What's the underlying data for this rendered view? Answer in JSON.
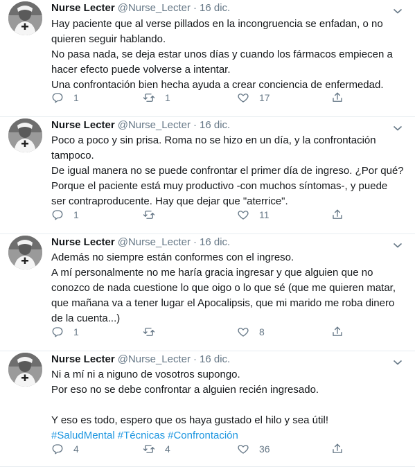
{
  "tweets": [
    {
      "name": "Nurse Lecter",
      "handle": "@Nurse_Lecter",
      "sep": "·",
      "date": "16 dic.",
      "lines": [
        "Hay paciente que al verse pillados en la incongruencia se enfadan, o no quieren seguir hablando.",
        "No pasa nada, se deja estar unos días y cuando los fármacos empiecen a hacer efecto puede volverse a intentar.",
        "Una confrontación bien hecha ayuda a crear conciencia de enfermedad."
      ],
      "hashtags": [],
      "replies": "1",
      "retweets": "1",
      "likes": "17"
    },
    {
      "name": "Nurse Lecter",
      "handle": "@Nurse_Lecter",
      "sep": "·",
      "date": "16 dic.",
      "lines": [
        "Poco a poco y sin prisa. Roma no se hizo en un día, y la confrontación tampoco.",
        "De igual manera no se puede confrontar el primer día de ingreso. ¿Por qué? Porque el paciente está muy productivo -con muchos síntomas-, y puede ser contraproducente. Hay que dejar que \"aterrice\"."
      ],
      "hashtags": [],
      "replies": "1",
      "retweets": "",
      "likes": "11"
    },
    {
      "name": "Nurse Lecter",
      "handle": "@Nurse_Lecter",
      "sep": "·",
      "date": "16 dic.",
      "lines": [
        "Además no siempre están conformes con el ingreso.",
        "A mí personalmente no me haría gracia ingresar y que alguien que no conozco de nada cuestione lo que oigo o lo que sé (que me quieren matar, que mañana va a tener lugar el Apocalipsis, que mi marido me roba dinero de la cuenta...)"
      ],
      "hashtags": [],
      "replies": "1",
      "retweets": "",
      "likes": "8"
    },
    {
      "name": "Nurse Lecter",
      "handle": "@Nurse_Lecter",
      "sep": "·",
      "date": "16 dic.",
      "lines": [
        "Ni a mí ni a niguno de vosotros supongo.",
        "Por eso no se debe confrontar a alguien recién ingresado.",
        "",
        "Y eso es todo, espero que os haya gustado el hilo y sea útil!"
      ],
      "hashtags": [
        "#SaludMental",
        "#Técnicas",
        "#Confrontación"
      ],
      "replies": "4",
      "retweets": "4",
      "likes": "36"
    }
  ],
  "icons": {
    "reply": "reply-icon",
    "retweet": "retweet-icon",
    "like": "heart-icon",
    "share": "share-icon",
    "menu": "chevron-down-icon"
  },
  "colors": {
    "text": "#14171a",
    "muted": "#657786",
    "link": "#1b95e0",
    "border": "#e6ecf0"
  }
}
